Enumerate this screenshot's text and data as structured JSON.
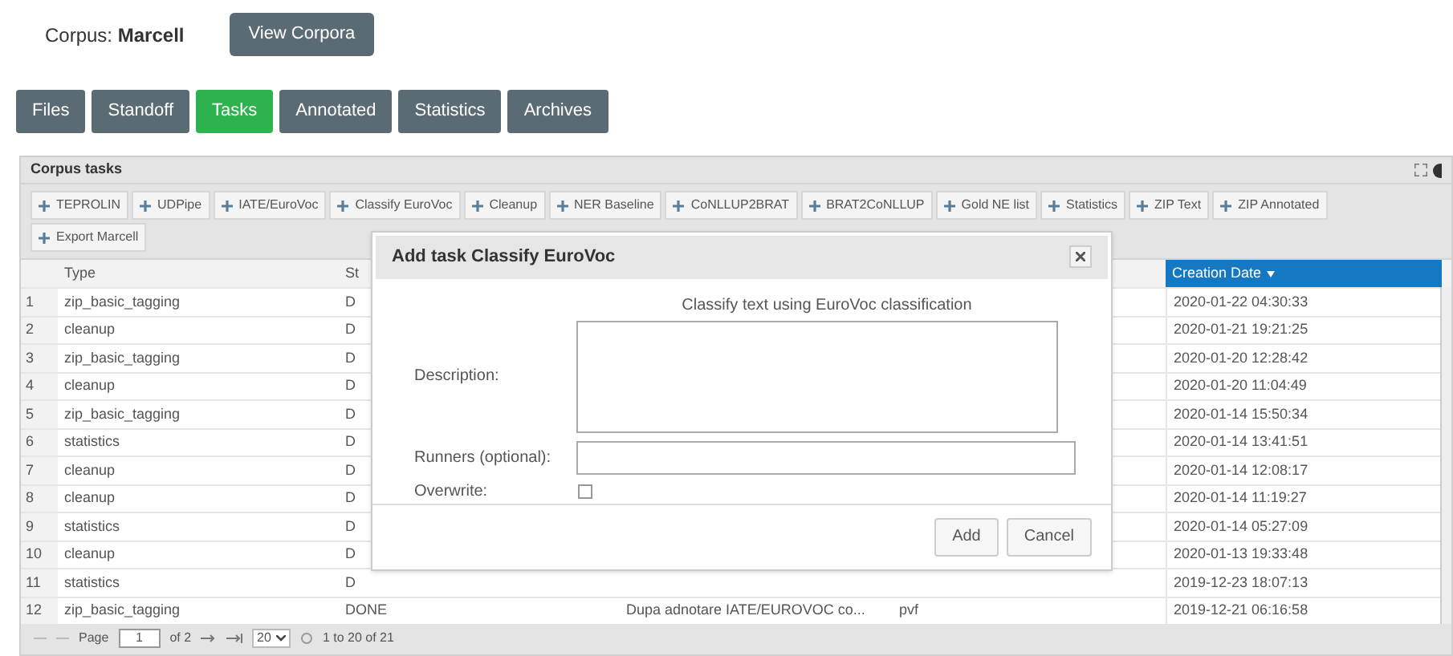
{
  "corpus": {
    "label": "Corpus:",
    "name": "Marcell"
  },
  "view_button": "View Corpora",
  "tabs": [
    {
      "label": "Files",
      "selected": false
    },
    {
      "label": "Standoff",
      "selected": false
    },
    {
      "label": "Tasks",
      "selected": true
    },
    {
      "label": "Annotated",
      "selected": false
    },
    {
      "label": "Statistics",
      "selected": false
    },
    {
      "label": "Archives",
      "selected": false
    }
  ],
  "panel": {
    "title": "Corpus tasks",
    "task_buttons": [
      "TEPROLIN",
      "UDPipe",
      "IATE/EuroVoc",
      "Classify EuroVoc",
      "Cleanup",
      "NER Baseline",
      "CoNLLUP2BRAT",
      "BRAT2CoNLLUP",
      "Gold NE list",
      "Statistics",
      "ZIP Text",
      "ZIP Annotated",
      "Export Marcell"
    ],
    "headers": {
      "type": "Type",
      "status": "St",
      "creation_date": "Creation Date"
    },
    "rows": [
      {
        "number": "1",
        "type": "zip_basic_tagging",
        "status": "D",
        "date": "2020-01-22 04:30:33"
      },
      {
        "number": "2",
        "type": "cleanup",
        "status": "D",
        "date": "2020-01-21 19:21:25"
      },
      {
        "number": "3",
        "type": "zip_basic_tagging",
        "status": "D",
        "date": "2020-01-20 12:28:42"
      },
      {
        "number": "4",
        "type": "cleanup",
        "status": "D",
        "date": "2020-01-20 11:04:49"
      },
      {
        "number": "5",
        "type": "zip_basic_tagging",
        "status": "D",
        "date": "2020-01-14 15:50:34"
      },
      {
        "number": "6",
        "type": "statistics",
        "status": "D",
        "date": "2020-01-14 13:41:51"
      },
      {
        "number": "7",
        "type": "cleanup",
        "status": "D",
        "date": "2020-01-14 12:08:17"
      },
      {
        "number": "8",
        "type": "cleanup",
        "status": "D",
        "date": "2020-01-14 11:19:27"
      },
      {
        "number": "9",
        "type": "statistics",
        "status": "D",
        "date": "2020-01-14 05:27:09"
      },
      {
        "number": "10",
        "type": "cleanup",
        "status": "D",
        "date": "2020-01-13 19:33:48"
      },
      {
        "number": "11",
        "type": "statistics",
        "status": "D",
        "date": "2019-12-23 18:07:13"
      },
      {
        "number": "12",
        "type": "zip_basic_tagging",
        "status": "DONE",
        "column_3": "Dupa adnotare IATE/EUROVOC co...",
        "column_4": "pvf",
        "date": "2019-12-21 06:16:58"
      }
    ],
    "pager": {
      "page_label": "Page",
      "page": "1",
      "of": "of 2",
      "page_size": "20",
      "summary": "1 to 20 of 21"
    }
  },
  "dialog": {
    "title": "Add task Classify EuroVoc",
    "intro": "Classify text using EuroVoc classification",
    "description_label": "Description:",
    "runners_label": "Runners (optional):",
    "overwrite_label": "Overwrite:",
    "overwrite": false,
    "buttons": [
      "Add",
      "Cancel"
    ]
  }
}
